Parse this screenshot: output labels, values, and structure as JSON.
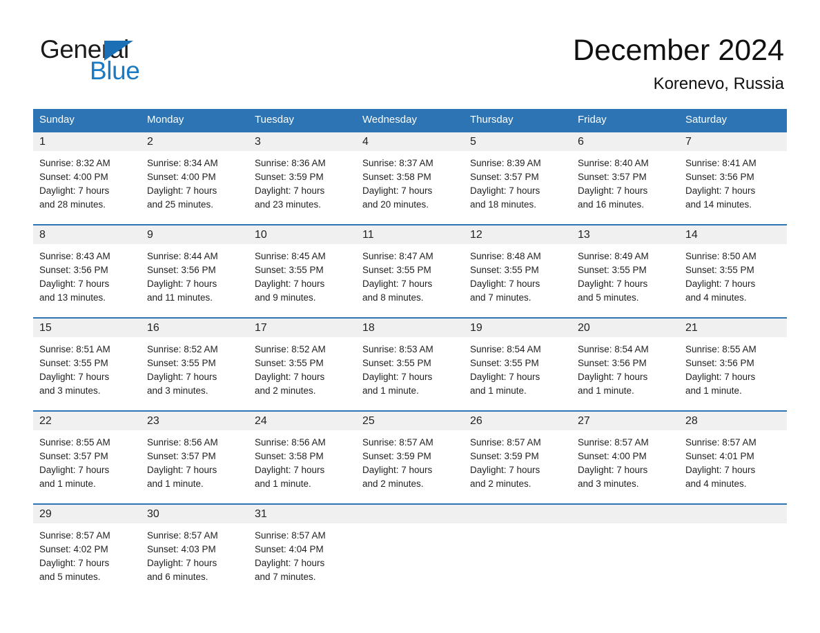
{
  "brand": {
    "name_part1": "General",
    "name_part2": "Blue",
    "logo_icon": "triangle-icon",
    "accent_color": "#1a7ac4"
  },
  "header": {
    "title": "December 2024",
    "location": "Korenevo, Russia"
  },
  "calendar": {
    "header_bg": "#2c74b3",
    "daynum_bg": "#f0f0f0",
    "weekdays": [
      "Sunday",
      "Monday",
      "Tuesday",
      "Wednesday",
      "Thursday",
      "Friday",
      "Saturday"
    ],
    "weeks": [
      [
        {
          "day": "1",
          "sunrise": "Sunrise: 8:32 AM",
          "sunset": "Sunset: 4:00 PM",
          "daylight1": "Daylight: 7 hours",
          "daylight2": "and 28 minutes."
        },
        {
          "day": "2",
          "sunrise": "Sunrise: 8:34 AM",
          "sunset": "Sunset: 4:00 PM",
          "daylight1": "Daylight: 7 hours",
          "daylight2": "and 25 minutes."
        },
        {
          "day": "3",
          "sunrise": "Sunrise: 8:36 AM",
          "sunset": "Sunset: 3:59 PM",
          "daylight1": "Daylight: 7 hours",
          "daylight2": "and 23 minutes."
        },
        {
          "day": "4",
          "sunrise": "Sunrise: 8:37 AM",
          "sunset": "Sunset: 3:58 PM",
          "daylight1": "Daylight: 7 hours",
          "daylight2": "and 20 minutes."
        },
        {
          "day": "5",
          "sunrise": "Sunrise: 8:39 AM",
          "sunset": "Sunset: 3:57 PM",
          "daylight1": "Daylight: 7 hours",
          "daylight2": "and 18 minutes."
        },
        {
          "day": "6",
          "sunrise": "Sunrise: 8:40 AM",
          "sunset": "Sunset: 3:57 PM",
          "daylight1": "Daylight: 7 hours",
          "daylight2": "and 16 minutes."
        },
        {
          "day": "7",
          "sunrise": "Sunrise: 8:41 AM",
          "sunset": "Sunset: 3:56 PM",
          "daylight1": "Daylight: 7 hours",
          "daylight2": "and 14 minutes."
        }
      ],
      [
        {
          "day": "8",
          "sunrise": "Sunrise: 8:43 AM",
          "sunset": "Sunset: 3:56 PM",
          "daylight1": "Daylight: 7 hours",
          "daylight2": "and 13 minutes."
        },
        {
          "day": "9",
          "sunrise": "Sunrise: 8:44 AM",
          "sunset": "Sunset: 3:56 PM",
          "daylight1": "Daylight: 7 hours",
          "daylight2": "and 11 minutes."
        },
        {
          "day": "10",
          "sunrise": "Sunrise: 8:45 AM",
          "sunset": "Sunset: 3:55 PM",
          "daylight1": "Daylight: 7 hours",
          "daylight2": "and 9 minutes."
        },
        {
          "day": "11",
          "sunrise": "Sunrise: 8:47 AM",
          "sunset": "Sunset: 3:55 PM",
          "daylight1": "Daylight: 7 hours",
          "daylight2": "and 8 minutes."
        },
        {
          "day": "12",
          "sunrise": "Sunrise: 8:48 AM",
          "sunset": "Sunset: 3:55 PM",
          "daylight1": "Daylight: 7 hours",
          "daylight2": "and 7 minutes."
        },
        {
          "day": "13",
          "sunrise": "Sunrise: 8:49 AM",
          "sunset": "Sunset: 3:55 PM",
          "daylight1": "Daylight: 7 hours",
          "daylight2": "and 5 minutes."
        },
        {
          "day": "14",
          "sunrise": "Sunrise: 8:50 AM",
          "sunset": "Sunset: 3:55 PM",
          "daylight1": "Daylight: 7 hours",
          "daylight2": "and 4 minutes."
        }
      ],
      [
        {
          "day": "15",
          "sunrise": "Sunrise: 8:51 AM",
          "sunset": "Sunset: 3:55 PM",
          "daylight1": "Daylight: 7 hours",
          "daylight2": "and 3 minutes."
        },
        {
          "day": "16",
          "sunrise": "Sunrise: 8:52 AM",
          "sunset": "Sunset: 3:55 PM",
          "daylight1": "Daylight: 7 hours",
          "daylight2": "and 3 minutes."
        },
        {
          "day": "17",
          "sunrise": "Sunrise: 8:52 AM",
          "sunset": "Sunset: 3:55 PM",
          "daylight1": "Daylight: 7 hours",
          "daylight2": "and 2 minutes."
        },
        {
          "day": "18",
          "sunrise": "Sunrise: 8:53 AM",
          "sunset": "Sunset: 3:55 PM",
          "daylight1": "Daylight: 7 hours",
          "daylight2": "and 1 minute."
        },
        {
          "day": "19",
          "sunrise": "Sunrise: 8:54 AM",
          "sunset": "Sunset: 3:55 PM",
          "daylight1": "Daylight: 7 hours",
          "daylight2": "and 1 minute."
        },
        {
          "day": "20",
          "sunrise": "Sunrise: 8:54 AM",
          "sunset": "Sunset: 3:56 PM",
          "daylight1": "Daylight: 7 hours",
          "daylight2": "and 1 minute."
        },
        {
          "day": "21",
          "sunrise": "Sunrise: 8:55 AM",
          "sunset": "Sunset: 3:56 PM",
          "daylight1": "Daylight: 7 hours",
          "daylight2": "and 1 minute."
        }
      ],
      [
        {
          "day": "22",
          "sunrise": "Sunrise: 8:55 AM",
          "sunset": "Sunset: 3:57 PM",
          "daylight1": "Daylight: 7 hours",
          "daylight2": "and 1 minute."
        },
        {
          "day": "23",
          "sunrise": "Sunrise: 8:56 AM",
          "sunset": "Sunset: 3:57 PM",
          "daylight1": "Daylight: 7 hours",
          "daylight2": "and 1 minute."
        },
        {
          "day": "24",
          "sunrise": "Sunrise: 8:56 AM",
          "sunset": "Sunset: 3:58 PM",
          "daylight1": "Daylight: 7 hours",
          "daylight2": "and 1 minute."
        },
        {
          "day": "25",
          "sunrise": "Sunrise: 8:57 AM",
          "sunset": "Sunset: 3:59 PM",
          "daylight1": "Daylight: 7 hours",
          "daylight2": "and 2 minutes."
        },
        {
          "day": "26",
          "sunrise": "Sunrise: 8:57 AM",
          "sunset": "Sunset: 3:59 PM",
          "daylight1": "Daylight: 7 hours",
          "daylight2": "and 2 minutes."
        },
        {
          "day": "27",
          "sunrise": "Sunrise: 8:57 AM",
          "sunset": "Sunset: 4:00 PM",
          "daylight1": "Daylight: 7 hours",
          "daylight2": "and 3 minutes."
        },
        {
          "day": "28",
          "sunrise": "Sunrise: 8:57 AM",
          "sunset": "Sunset: 4:01 PM",
          "daylight1": "Daylight: 7 hours",
          "daylight2": "and 4 minutes."
        }
      ],
      [
        {
          "day": "29",
          "sunrise": "Sunrise: 8:57 AM",
          "sunset": "Sunset: 4:02 PM",
          "daylight1": "Daylight: 7 hours",
          "daylight2": "and 5 minutes."
        },
        {
          "day": "30",
          "sunrise": "Sunrise: 8:57 AM",
          "sunset": "Sunset: 4:03 PM",
          "daylight1": "Daylight: 7 hours",
          "daylight2": "and 6 minutes."
        },
        {
          "day": "31",
          "sunrise": "Sunrise: 8:57 AM",
          "sunset": "Sunset: 4:04 PM",
          "daylight1": "Daylight: 7 hours",
          "daylight2": "and 7 minutes."
        },
        {
          "day": "",
          "sunrise": "",
          "sunset": "",
          "daylight1": "",
          "daylight2": ""
        },
        {
          "day": "",
          "sunrise": "",
          "sunset": "",
          "daylight1": "",
          "daylight2": ""
        },
        {
          "day": "",
          "sunrise": "",
          "sunset": "",
          "daylight1": "",
          "daylight2": ""
        },
        {
          "day": "",
          "sunrise": "",
          "sunset": "",
          "daylight1": "",
          "daylight2": ""
        }
      ]
    ]
  }
}
